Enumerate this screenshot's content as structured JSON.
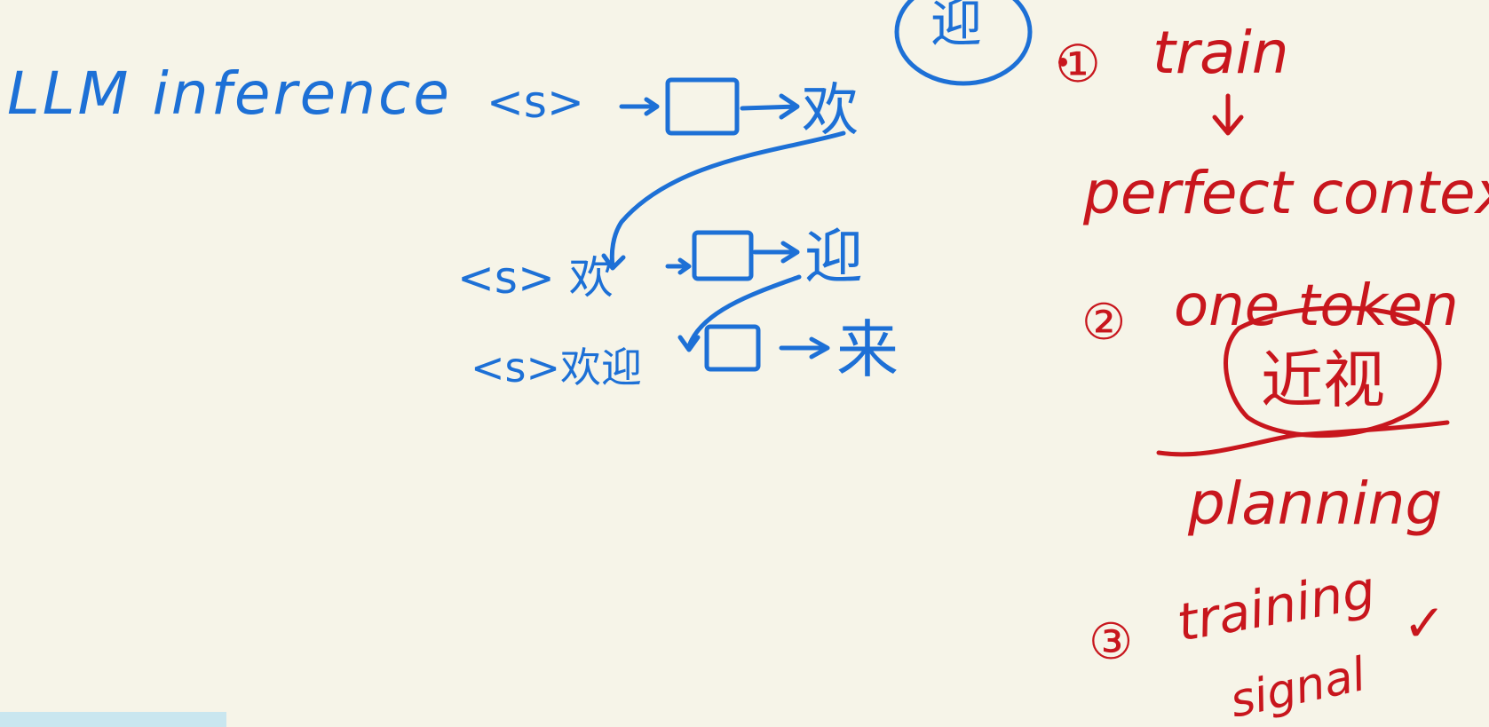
{
  "title": "LLM inference",
  "colors": {
    "background": "#f6f4e8",
    "blue_ink": "#1d70d6",
    "red_ink": "#c8161d"
  },
  "diagram": {
    "rows": [
      {
        "prefix": "<s>",
        "output": "欢"
      },
      {
        "prefix": "<s> 欢",
        "output": "迎"
      },
      {
        "prefix": "<s>欢迎",
        "output": "来"
      }
    ],
    "circled_top_char": "迎"
  },
  "notes": {
    "n1_marker": "①",
    "n1_text": "train",
    "n1_sub": "perfect context",
    "n2_marker": "②",
    "n2_text": "one token",
    "n2_circled": "近视",
    "n2_sub": "planning",
    "n3_marker": "③",
    "n3_text": "training",
    "n3_sub": "signal",
    "n3_check": "✓"
  }
}
